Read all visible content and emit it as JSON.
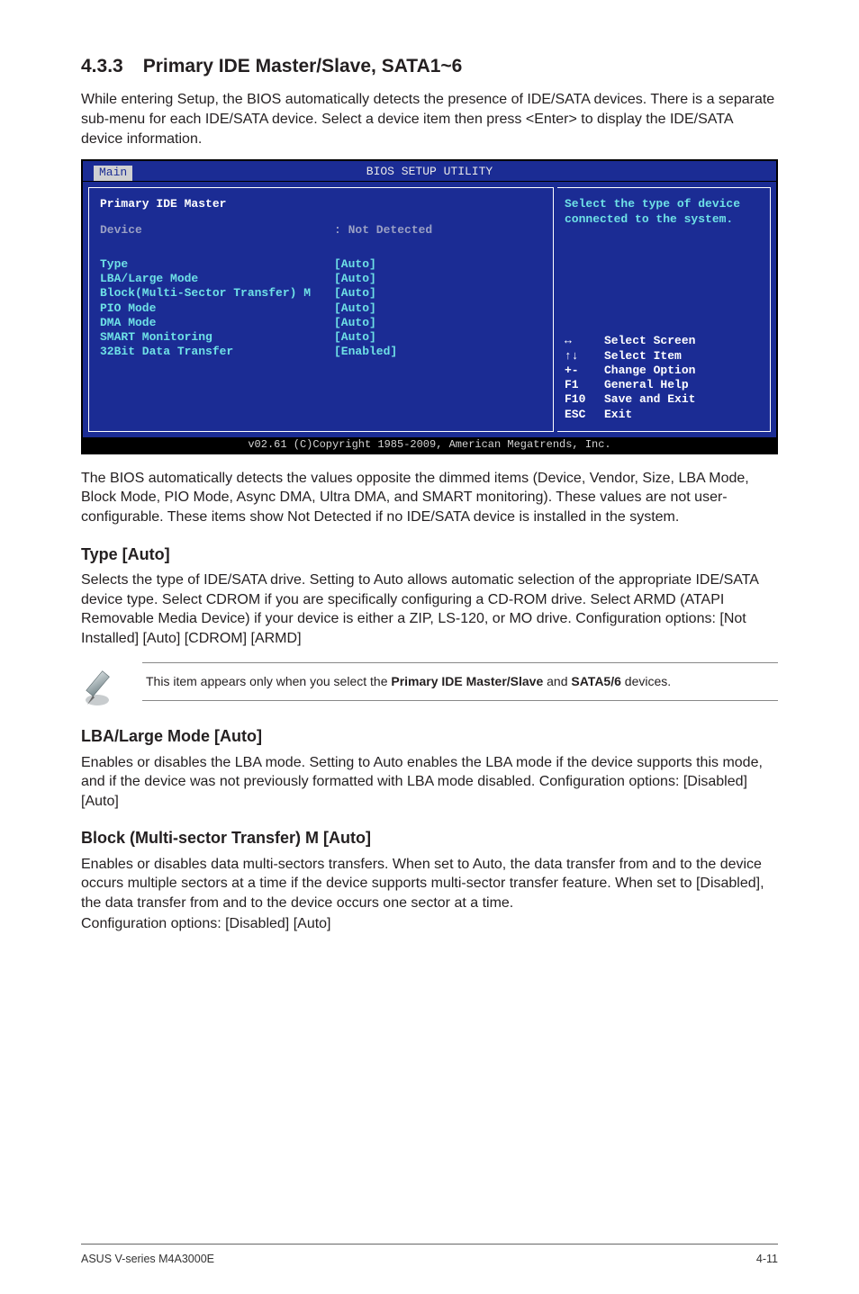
{
  "section": {
    "number": "4.3.3",
    "title": "Primary IDE Master/Slave, SATA1~6",
    "intro": "While entering Setup, the BIOS automatically detects the presence of IDE/SATA devices. There is a separate sub-menu for each IDE/SATA device. Select a device item then press <Enter> to display the IDE/SATA device information."
  },
  "bios": {
    "header": "BIOS SETUP UTILITY",
    "active_tab": "Main",
    "left": {
      "panel_title": "Primary IDE Master",
      "device_label": "Device",
      "device_value": ": Not Detected",
      "rows": [
        {
          "label": "Type",
          "value": "[Auto]"
        },
        {
          "label": "LBA/Large Mode",
          "value": "[Auto]"
        },
        {
          "label": "Block(Multi-Sector Transfer) M",
          "value": "[Auto]"
        },
        {
          "label": "PIO Mode",
          "value": "[Auto]"
        },
        {
          "label": "DMA Mode",
          "value": "[Auto]"
        },
        {
          "label": "SMART Monitoring",
          "value": "[Auto]"
        },
        {
          "label": "32Bit Data Transfer",
          "value": "[Enabled]"
        }
      ]
    },
    "right_top": "Select the type of device connected to the system.",
    "keys": [
      {
        "k": "↔",
        "d": "Select Screen"
      },
      {
        "k": "↑↓",
        "d": "Select Item"
      },
      {
        "k": "+-",
        "d": "Change Option"
      },
      {
        "k": "F1",
        "d": "General Help"
      },
      {
        "k": "F10",
        "d": "Save and Exit"
      },
      {
        "k": "ESC",
        "d": "Exit"
      }
    ],
    "footer": "v02.61 (C)Copyright 1985-2009, American Megatrends, Inc."
  },
  "after_bios_para": "The BIOS automatically detects the values opposite the dimmed items (Device, Vendor, Size, LBA Mode, Block Mode, PIO Mode, Async DMA, Ultra DMA, and SMART monitoring). These values are not user-configurable. These items show Not Detected if no IDE/SATA device is installed in the system.",
  "type_sec": {
    "heading": "Type [Auto]",
    "body": "Selects the type of IDE/SATA drive. Setting to Auto allows automatic selection of the appropriate IDE/SATA device type. Select CDROM if you are specifically configuring a CD-ROM drive. Select ARMD (ATAPI Removable Media Device) if your device is either a ZIP, LS-120, or MO drive. Configuration options: [Not Installed] [Auto] [CDROM] [ARMD]"
  },
  "note": {
    "pre": "This item appears only when you select the ",
    "bold1": "Primary IDE Master/Slave",
    "mid": " and ",
    "bold2": "SATA5/6",
    "post": " devices."
  },
  "lba_sec": {
    "heading": "LBA/Large Mode [Auto]",
    "body": "Enables or disables the LBA mode. Setting to Auto enables the LBA mode if the device supports this mode, and if the device was not previously formatted with LBA mode disabled. Configuration options: [Disabled] [Auto]"
  },
  "block_sec": {
    "heading": "Block (Multi-sector Transfer) M [Auto]",
    "body": "Enables or disables data multi-sectors transfers. When set to Auto, the data transfer from and to the device occurs multiple sectors at a time if the device supports multi-sector transfer feature. When set to [Disabled], the data transfer from and to the device occurs one sector at a time.",
    "body2": "Configuration options: [Disabled] [Auto]"
  },
  "footer": {
    "left": "ASUS V-series M4A3000E",
    "right": "4-11"
  }
}
